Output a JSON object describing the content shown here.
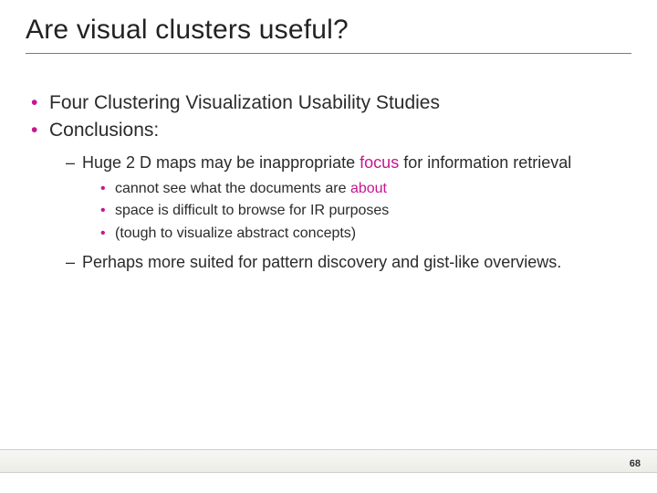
{
  "title": "Are visual clusters useful?",
  "bullets": {
    "b1": "Four Clustering Visualization Usability Studies",
    "b2": "Conclusions:",
    "b2_1_pre": "Huge 2 D maps may be inappropriate ",
    "b2_1_hl": "focus",
    "b2_1_post": " for information retrieval",
    "b2_1_a_pre": "cannot see what the documents are ",
    "b2_1_a_hl": "about",
    "b2_1_b": "space is difficult to browse for IR purposes",
    "b2_1_c": "(tough to visualize abstract concepts)",
    "b2_2": "Perhaps more suited for pattern discovery and gist-like overviews."
  },
  "page_number": "68",
  "colors": {
    "accent": "#c6168d"
  }
}
